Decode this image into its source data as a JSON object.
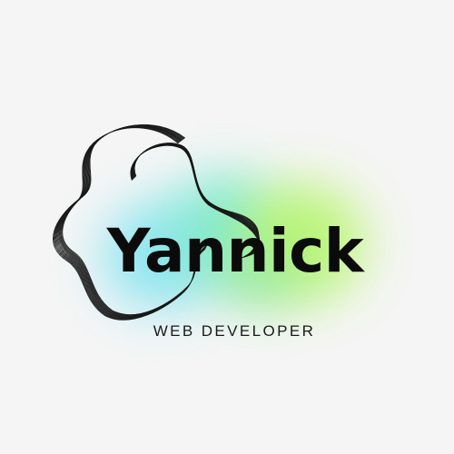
{
  "logo": {
    "name": "Yannick",
    "tagline": "WEB DEVELOPER"
  },
  "colors": {
    "background": "#f5f5f5",
    "text": "#0b0b0b",
    "gradient_cyan": "#7fe3f0",
    "gradient_teal": "#6fe8c8",
    "gradient_lime": "#b6f56a",
    "line_art": "#1a1a1a"
  }
}
